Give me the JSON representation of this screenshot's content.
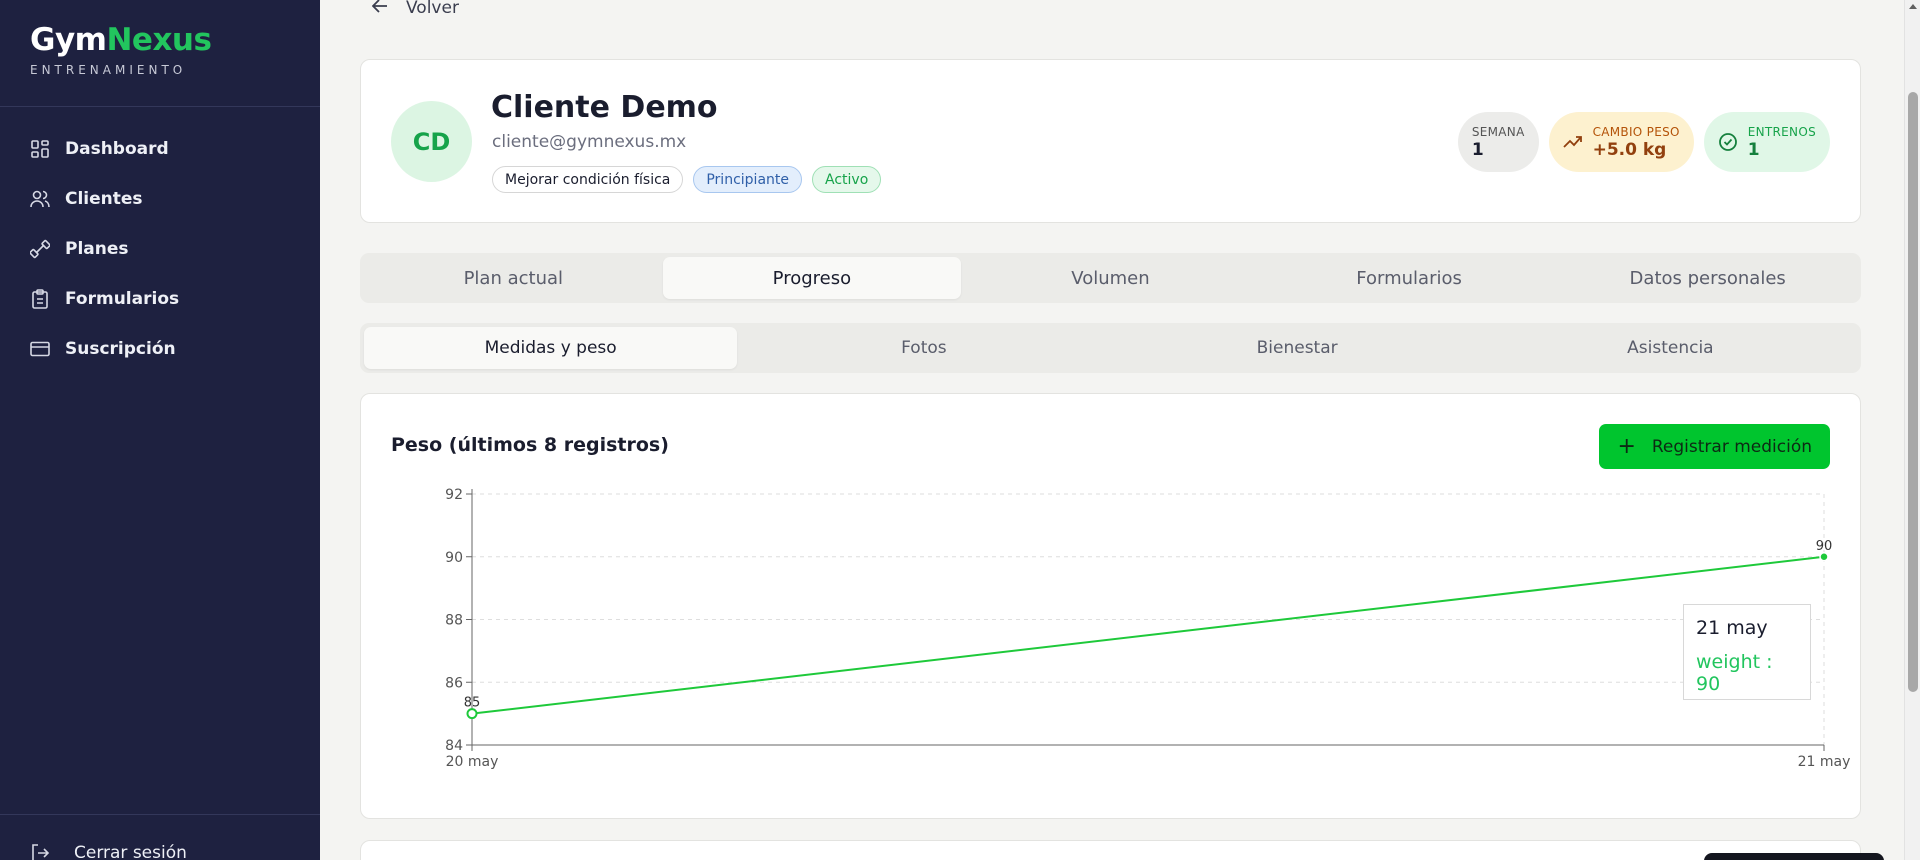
{
  "brand": {
    "name_part1": "Gym",
    "name_part2": "Nexus",
    "subtitle": "ENTRENAMIENTO"
  },
  "sidebar": {
    "items": [
      {
        "label": "Dashboard",
        "icon": "dashboard-icon"
      },
      {
        "label": "Clientes",
        "icon": "users-icon"
      },
      {
        "label": "Planes",
        "icon": "dumbbell-icon"
      },
      {
        "label": "Formularios",
        "icon": "clipboard-icon"
      },
      {
        "label": "Suscripción",
        "icon": "credit-card-icon"
      }
    ],
    "logout_label": "Cerrar sesión"
  },
  "back_label": "Volver",
  "client": {
    "initials": "CD",
    "name": "Cliente Demo",
    "email": "cliente@gymnexus.mx",
    "tags": {
      "goal": "Mejorar condición física",
      "level": "Principiante",
      "status": "Activo"
    },
    "stats": {
      "week": {
        "label": "SEMANA",
        "value": "1"
      },
      "weight_change": {
        "label": "CAMBIO PESO",
        "value": "+5.0 kg"
      },
      "workouts": {
        "label": "ENTRENOS",
        "value": "1"
      }
    }
  },
  "tabs": [
    "Plan actual",
    "Progreso",
    "Volumen",
    "Formularios",
    "Datos personales"
  ],
  "active_tab": "Progreso",
  "subtabs": [
    "Medidas y peso",
    "Fotos",
    "Bienestar",
    "Asistencia"
  ],
  "active_subtab": "Medidas y peso",
  "chart_section": {
    "title": "Peso (últimos 8 registros)",
    "add_button": "Registrar medición",
    "tooltip": {
      "label": "21 may",
      "value_text": "weight : 90"
    }
  },
  "colors": {
    "accent": "#22c55e",
    "sidebar_bg": "#1e2140",
    "button_bg": "#00c52e"
  },
  "chart_data": {
    "type": "line",
    "x": [
      "20 may",
      "21 may"
    ],
    "series": [
      {
        "name": "weight",
        "values": [
          85,
          90
        ]
      }
    ],
    "ylim": [
      84,
      92
    ],
    "yticks": [
      84,
      86,
      88,
      90,
      92
    ],
    "grid": true,
    "data_labels": [
      "85",
      "90"
    ]
  }
}
